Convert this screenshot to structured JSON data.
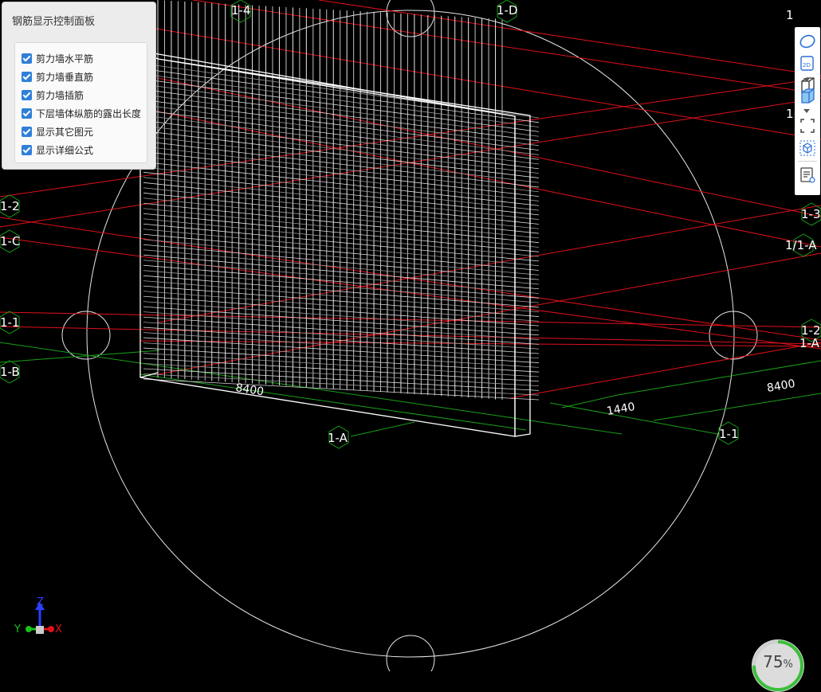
{
  "control_panel": {
    "title": "钢筋显示控制面板",
    "options": [
      {
        "label": "剪力墙水平筋",
        "checked": true
      },
      {
        "label": "剪力墙垂直筋",
        "checked": true
      },
      {
        "label": "剪力墙插筋",
        "checked": true
      },
      {
        "label": "下层墙体纵筋的露出长度",
        "checked": true
      },
      {
        "label": "显示其它图元",
        "checked": true
      },
      {
        "label": "显示详细公式",
        "checked": true
      }
    ]
  },
  "axis_labels": {
    "top_left": "1-4",
    "top_right": "1-D",
    "left_1": "1-2",
    "left_2": "1-C",
    "left_3": "1-1",
    "left_4": "1-B",
    "bottom_center": "1-A",
    "bottom_right": "1-1",
    "right_1": "1",
    "right_2": "1",
    "right_3": "1-3",
    "right_4": "1/1-A",
    "right_5": "1-2",
    "right_6": "1-A"
  },
  "dimensions": {
    "wall_length": "8400",
    "offset": "1440",
    "span": "8400"
  },
  "triad": {
    "x": "X",
    "y": "Y",
    "z": "Z"
  },
  "toolbar": {
    "view2d_label": "2D",
    "icons": [
      "orbit-icon",
      "2d-view-icon",
      "wireframe-box-icon",
      "solid-box-icon",
      "fit-view-icon",
      "isometric-icon",
      "report-icon"
    ]
  },
  "zoom": {
    "value": "75",
    "unit": "%"
  },
  "colors": {
    "background": "#000000",
    "axis_red": "#e0101a",
    "dimension_green": "#18a018",
    "rebar": "#ffffff",
    "checkbox": "#2f7fd8",
    "zoom_ring": "#3bbf3b"
  }
}
